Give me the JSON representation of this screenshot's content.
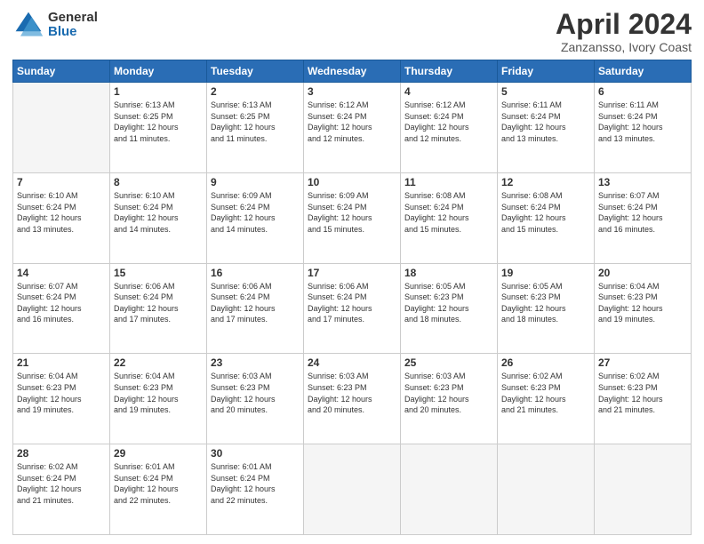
{
  "header": {
    "logo_general": "General",
    "logo_blue": "Blue",
    "title": "April 2024",
    "subtitle": "Zanzansso, Ivory Coast"
  },
  "weekdays": [
    "Sunday",
    "Monday",
    "Tuesday",
    "Wednesday",
    "Thursday",
    "Friday",
    "Saturday"
  ],
  "weeks": [
    [
      {
        "day": "",
        "info": ""
      },
      {
        "day": "1",
        "info": "Sunrise: 6:13 AM\nSunset: 6:25 PM\nDaylight: 12 hours\nand 11 minutes."
      },
      {
        "day": "2",
        "info": "Sunrise: 6:13 AM\nSunset: 6:25 PM\nDaylight: 12 hours\nand 11 minutes."
      },
      {
        "day": "3",
        "info": "Sunrise: 6:12 AM\nSunset: 6:24 PM\nDaylight: 12 hours\nand 12 minutes."
      },
      {
        "day": "4",
        "info": "Sunrise: 6:12 AM\nSunset: 6:24 PM\nDaylight: 12 hours\nand 12 minutes."
      },
      {
        "day": "5",
        "info": "Sunrise: 6:11 AM\nSunset: 6:24 PM\nDaylight: 12 hours\nand 13 minutes."
      },
      {
        "day": "6",
        "info": "Sunrise: 6:11 AM\nSunset: 6:24 PM\nDaylight: 12 hours\nand 13 minutes."
      }
    ],
    [
      {
        "day": "7",
        "info": "Sunrise: 6:10 AM\nSunset: 6:24 PM\nDaylight: 12 hours\nand 13 minutes."
      },
      {
        "day": "8",
        "info": "Sunrise: 6:10 AM\nSunset: 6:24 PM\nDaylight: 12 hours\nand 14 minutes."
      },
      {
        "day": "9",
        "info": "Sunrise: 6:09 AM\nSunset: 6:24 PM\nDaylight: 12 hours\nand 14 minutes."
      },
      {
        "day": "10",
        "info": "Sunrise: 6:09 AM\nSunset: 6:24 PM\nDaylight: 12 hours\nand 15 minutes."
      },
      {
        "day": "11",
        "info": "Sunrise: 6:08 AM\nSunset: 6:24 PM\nDaylight: 12 hours\nand 15 minutes."
      },
      {
        "day": "12",
        "info": "Sunrise: 6:08 AM\nSunset: 6:24 PM\nDaylight: 12 hours\nand 15 minutes."
      },
      {
        "day": "13",
        "info": "Sunrise: 6:07 AM\nSunset: 6:24 PM\nDaylight: 12 hours\nand 16 minutes."
      }
    ],
    [
      {
        "day": "14",
        "info": "Sunrise: 6:07 AM\nSunset: 6:24 PM\nDaylight: 12 hours\nand 16 minutes."
      },
      {
        "day": "15",
        "info": "Sunrise: 6:06 AM\nSunset: 6:24 PM\nDaylight: 12 hours\nand 17 minutes."
      },
      {
        "day": "16",
        "info": "Sunrise: 6:06 AM\nSunset: 6:24 PM\nDaylight: 12 hours\nand 17 minutes."
      },
      {
        "day": "17",
        "info": "Sunrise: 6:06 AM\nSunset: 6:24 PM\nDaylight: 12 hours\nand 17 minutes."
      },
      {
        "day": "18",
        "info": "Sunrise: 6:05 AM\nSunset: 6:23 PM\nDaylight: 12 hours\nand 18 minutes."
      },
      {
        "day": "19",
        "info": "Sunrise: 6:05 AM\nSunset: 6:23 PM\nDaylight: 12 hours\nand 18 minutes."
      },
      {
        "day": "20",
        "info": "Sunrise: 6:04 AM\nSunset: 6:23 PM\nDaylight: 12 hours\nand 19 minutes."
      }
    ],
    [
      {
        "day": "21",
        "info": "Sunrise: 6:04 AM\nSunset: 6:23 PM\nDaylight: 12 hours\nand 19 minutes."
      },
      {
        "day": "22",
        "info": "Sunrise: 6:04 AM\nSunset: 6:23 PM\nDaylight: 12 hours\nand 19 minutes."
      },
      {
        "day": "23",
        "info": "Sunrise: 6:03 AM\nSunset: 6:23 PM\nDaylight: 12 hours\nand 20 minutes."
      },
      {
        "day": "24",
        "info": "Sunrise: 6:03 AM\nSunset: 6:23 PM\nDaylight: 12 hours\nand 20 minutes."
      },
      {
        "day": "25",
        "info": "Sunrise: 6:03 AM\nSunset: 6:23 PM\nDaylight: 12 hours\nand 20 minutes."
      },
      {
        "day": "26",
        "info": "Sunrise: 6:02 AM\nSunset: 6:23 PM\nDaylight: 12 hours\nand 21 minutes."
      },
      {
        "day": "27",
        "info": "Sunrise: 6:02 AM\nSunset: 6:23 PM\nDaylight: 12 hours\nand 21 minutes."
      }
    ],
    [
      {
        "day": "28",
        "info": "Sunrise: 6:02 AM\nSunset: 6:24 PM\nDaylight: 12 hours\nand 21 minutes."
      },
      {
        "day": "29",
        "info": "Sunrise: 6:01 AM\nSunset: 6:24 PM\nDaylight: 12 hours\nand 22 minutes."
      },
      {
        "day": "30",
        "info": "Sunrise: 6:01 AM\nSunset: 6:24 PM\nDaylight: 12 hours\nand 22 minutes."
      },
      {
        "day": "",
        "info": ""
      },
      {
        "day": "",
        "info": ""
      },
      {
        "day": "",
        "info": ""
      },
      {
        "day": "",
        "info": ""
      }
    ]
  ]
}
